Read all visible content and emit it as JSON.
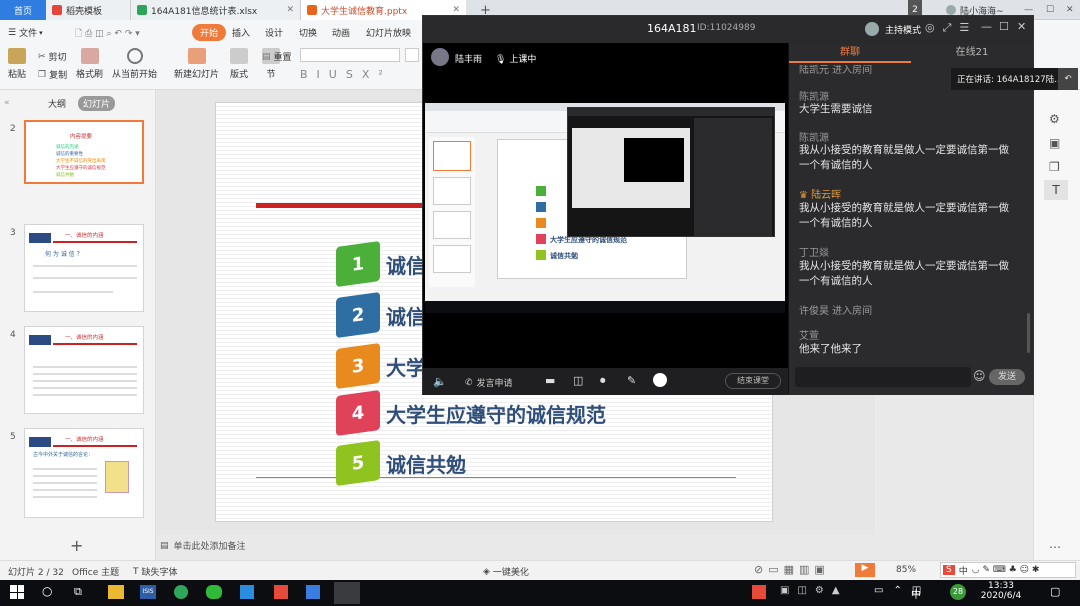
{
  "tabs": {
    "home": "首页",
    "docer": "稻壳模板",
    "xlsx": "164A181信息统计表.xlsx",
    "pptx": "大学生诚信教育.pptx",
    "badge": "2",
    "user": "陆小海海~"
  },
  "ribbon": {
    "file_menu": "文件",
    "tabs": [
      "开始",
      "插入",
      "设计",
      "切换",
      "动画",
      "幻灯片放映"
    ],
    "paste": "粘贴",
    "cut": "剪切",
    "copy": "复制",
    "format_painter": "格式刷",
    "from_current": "从当前开始",
    "new_slide": "新建幻灯片",
    "layout": "版式",
    "section": "节",
    "reset": "重置"
  },
  "leftpanel": {
    "outline_tab": "大纲",
    "slides_tab": "幻灯片",
    "slide_numbers": [
      "2",
      "3",
      "4",
      "5"
    ],
    "add_label": "+",
    "thumb2_title": "内容提要",
    "thumb2_items": [
      "诚信的内涵",
      "诚信的重要性",
      "大学生不诚信的突出表现",
      "大学生应遵守的诚信规范",
      "诚信共勉"
    ],
    "thumb3_title": "一、诚信的内涵",
    "thumb3_sub": "何 为 诚 信 ？",
    "thumb4_title": "一、诚信的内涵",
    "thumb5_title": "一、诚信的内涵",
    "thumb5_sub": "古今中外关于诚信的言论："
  },
  "slide": {
    "items": [
      {
        "num": "1",
        "text": "诚信",
        "color": "#4caf3a"
      },
      {
        "num": "2",
        "text": "诚信",
        "color": "#2f6ea3"
      },
      {
        "num": "3",
        "text": "大学",
        "color": "#e88a1e"
      },
      {
        "num": "4",
        "text": "大学生应遵守的诚信规范",
        "color": "#e0425a"
      },
      {
        "num": "5",
        "text": "诚信共勉",
        "color": "#8fc31f"
      }
    ],
    "notes_placeholder": "单击此处添加备注"
  },
  "meeting": {
    "room": "164A181",
    "id": "ID:11024989",
    "host_mode": "主持模式",
    "presenter_name": "陆丰雨",
    "class_status": "上课中",
    "speak_request": "发言申请",
    "end_class": "结束课堂",
    "chat_tab": "群聊",
    "online_tab": "在线21",
    "now_speaking": "正在讲话: 164A18127陆...",
    "send": "发送",
    "messages": [
      {
        "name": "陈凯源",
        "text": "大学生需要诚信"
      },
      {
        "name": "陈凯源",
        "text": "我从小接受的教育就是做人一定要诚信第一做一个有诚信的人"
      },
      {
        "name": "陆云晖",
        "text": "我从小接受的教育就是做人一定要诚信第一做一个有诚信的人"
      },
      {
        "name": "丁卫燚",
        "text": "我从小接受的教育就是做人一定要诚信第一做一个有诚信的人"
      },
      {
        "name": "许俊昊 进入房间",
        "text": ""
      },
      {
        "name": "艾萱",
        "text": "他来了他来了"
      }
    ],
    "top_partial": "陆凯元 进入房间"
  },
  "status": {
    "slide_info": "幻灯片 2 / 32",
    "theme": "Office 主题",
    "font_missing": "缺失字体",
    "beautify": "一键美化",
    "zoom": "85%"
  },
  "taskbar": {
    "time": "13:33",
    "date": "2020/6/4",
    "ime": "中",
    "badge": "28",
    "ime2": "中"
  },
  "colors": {
    "accent_blue": "#2f7de1",
    "brand_orange": "#f07a3a",
    "chat_bg": "#2b2b2d"
  }
}
